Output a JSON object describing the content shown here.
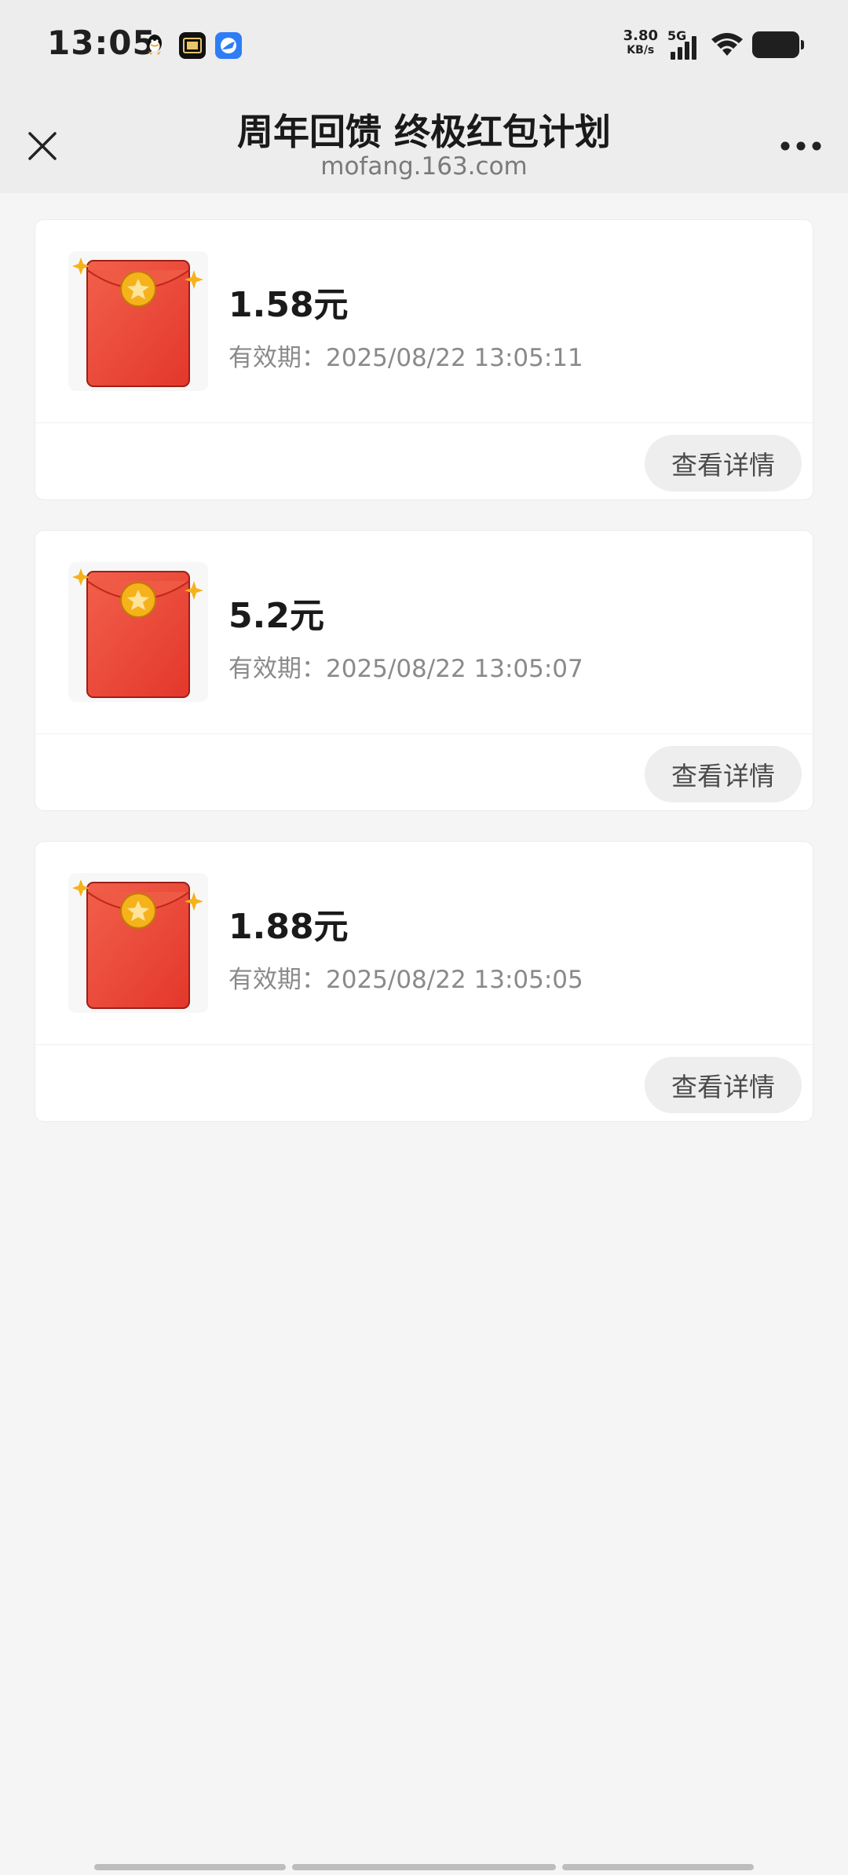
{
  "status_bar": {
    "time": "13:05",
    "net_speed_value": "3.80",
    "net_speed_unit": "KB/s",
    "network_type": "5G",
    "notification_icons": [
      "qq-icon",
      "tv-app-icon",
      "browser-icon"
    ]
  },
  "title_bar": {
    "title": "周年回馈 终极红包计划",
    "domain": "mofang.163.com",
    "close_icon": "close-icon",
    "more_icon": "more-dots-icon"
  },
  "cards": [
    {
      "amount": "1.58元",
      "expiry_label": "有效期：",
      "expiry_time": "2025/08/22 13:05:11",
      "button_label": "查看详情"
    },
    {
      "amount": "5.2元",
      "expiry_label": "有效期：",
      "expiry_time": "2025/08/22 13:05:07",
      "button_label": "查看详情"
    },
    {
      "amount": "1.88元",
      "expiry_label": "有效期：",
      "expiry_time": "2025/08/22 13:05:05",
      "button_label": "查看详情"
    }
  ],
  "colors": {
    "envelope_red": "#e8402f",
    "envelope_gold": "#f6b21b",
    "background": "#f5f5f5",
    "card": "#ffffff"
  }
}
